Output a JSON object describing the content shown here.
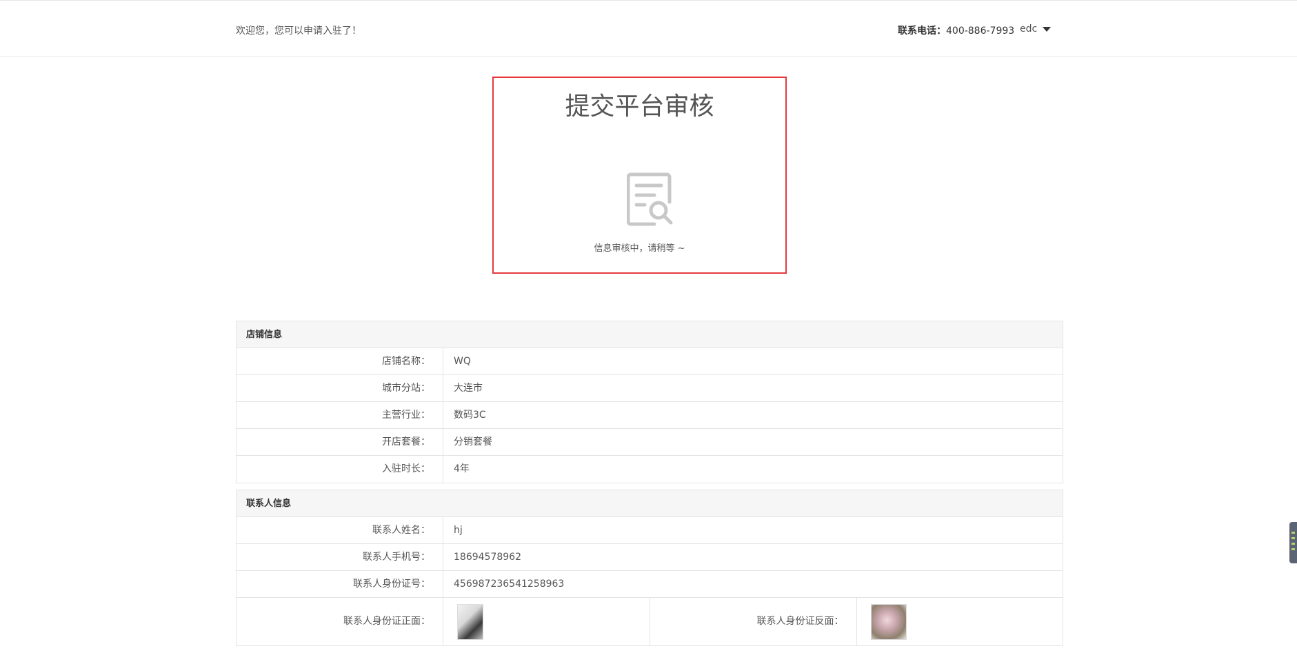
{
  "header": {
    "welcome": "欢迎您，您可以申请入驻了！",
    "contact_label": "联系电话：",
    "contact_phone": "400-886-7993",
    "user_name": "edc"
  },
  "status": {
    "title": "提交平台审核",
    "message": "信息审核中，请稍等 ~",
    "icon": "document-search-icon",
    "border_color": "#e4393c"
  },
  "shop_info": {
    "heading": "店铺信息",
    "rows": [
      {
        "label": "店铺名称：",
        "value": "WQ"
      },
      {
        "label": "城市分站：",
        "value": "大连市"
      },
      {
        "label": "主营行业：",
        "value": "数码3C"
      },
      {
        "label": "开店套餐：",
        "value": "分销套餐"
      },
      {
        "label": "入驻时长：",
        "value": "4年"
      }
    ]
  },
  "contact_info": {
    "heading": "联系人信息",
    "rows": [
      {
        "label": "联系人姓名：",
        "value": "hj"
      },
      {
        "label": "联系人手机号：",
        "value": "18694578962"
      },
      {
        "label": "联系人身份证号：",
        "value": "456987236541258963"
      }
    ],
    "id_front_label": "联系人身份证正面：",
    "id_back_label": "联系人身份证反面："
  }
}
